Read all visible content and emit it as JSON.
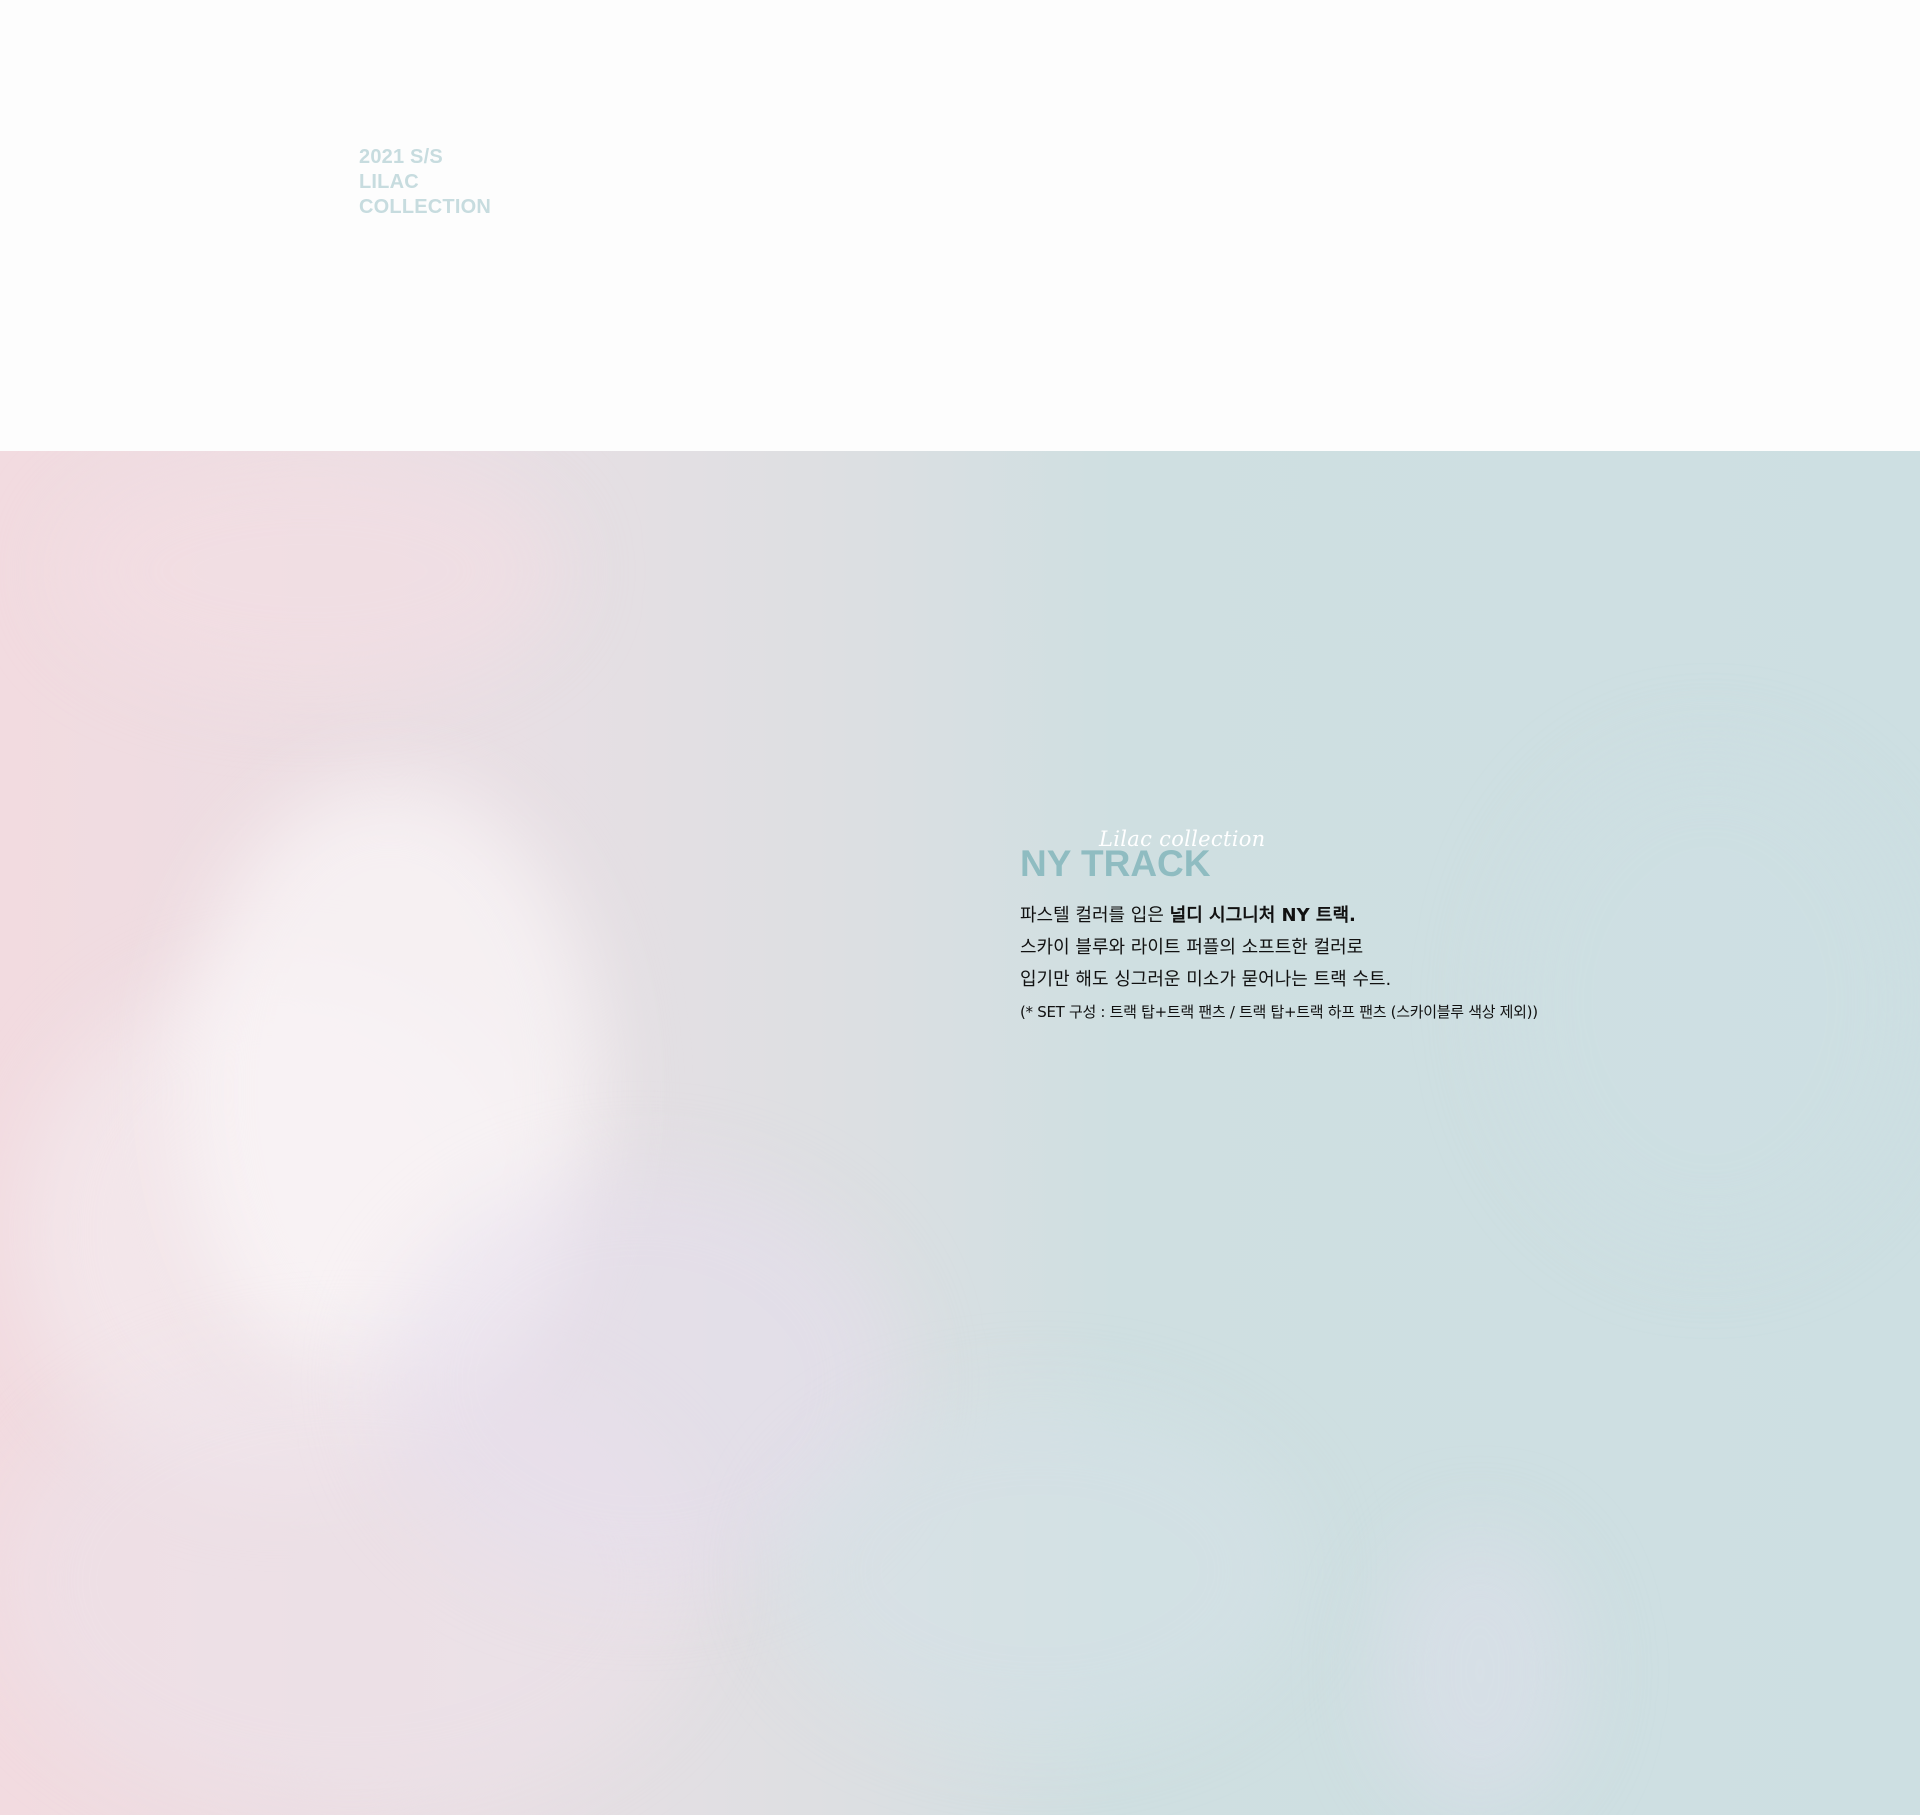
{
  "header": {
    "collection_lines": [
      "2021 S/S",
      "LILAC",
      "COLLECTION"
    ]
  },
  "hero": {
    "script_label": "Lilac collection",
    "title": "NY TRACK",
    "description": {
      "line1_prefix": "파스텔 컬러를 입은 ",
      "line1_emphasis": "널디 시그니처 NY 트랙.",
      "line2": "스카이 블루와 라이트 퍼플의 소프트한 컬러로",
      "line3": "입기만 해도 싱그러운 미소가 묻어나는 트랙 수트.",
      "note": "(* SET 구성 : 트랙 탑+트랙 팬츠 /  트랙 탑+트랙 하프 팬츠 (스카이블루 색상 제외))"
    }
  },
  "colors": {
    "tag_text": "#c7dcdf",
    "title_text": "#8fbcc1",
    "body_text": "#111111",
    "page_background": "#fdfdfd"
  }
}
